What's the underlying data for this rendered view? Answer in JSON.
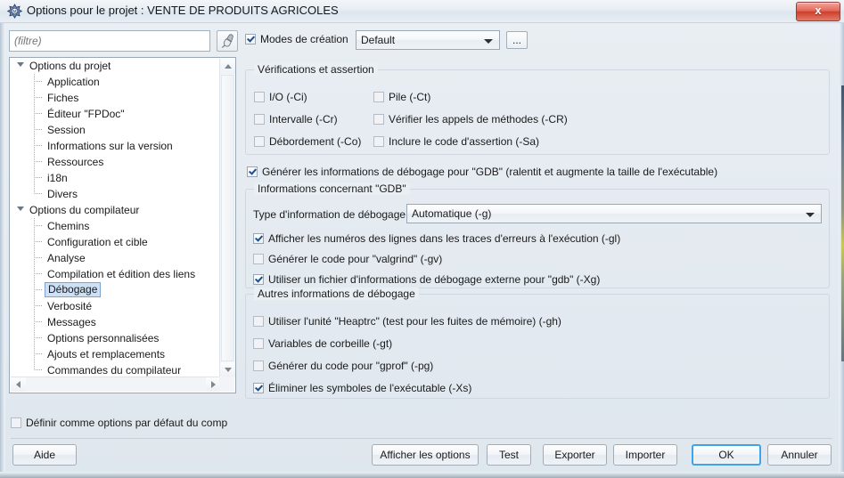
{
  "window": {
    "title": "Options pour le projet : VENTE DE PRODUITS AGRICOLES",
    "app_icon": "lazarus-icon",
    "close_label": "x",
    "accent": "#3ea4e8",
    "close_color": "#cf3f2c"
  },
  "filter": {
    "placeholder": "(filtre)",
    "value": "",
    "clear_icon": "brush-icon"
  },
  "tree": {
    "items": [
      {
        "label": "Options du projet",
        "level": 0,
        "expanded": true,
        "selected": false
      },
      {
        "label": "Application",
        "level": 1,
        "expanded": false,
        "selected": false
      },
      {
        "label": "Fiches",
        "level": 1,
        "expanded": false,
        "selected": false
      },
      {
        "label": "Éditeur \"FPDoc\"",
        "level": 1,
        "expanded": false,
        "selected": false
      },
      {
        "label": "Session",
        "level": 1,
        "expanded": false,
        "selected": false
      },
      {
        "label": "Informations sur la version",
        "level": 1,
        "expanded": false,
        "selected": false
      },
      {
        "label": "Ressources",
        "level": 1,
        "expanded": false,
        "selected": false
      },
      {
        "label": "i18n",
        "level": 1,
        "expanded": false,
        "selected": false
      },
      {
        "label": "Divers",
        "level": 1,
        "expanded": false,
        "selected": false
      },
      {
        "label": "Options du compilateur",
        "level": 0,
        "expanded": true,
        "selected": false
      },
      {
        "label": "Chemins",
        "level": 1,
        "expanded": false,
        "selected": false
      },
      {
        "label": "Configuration et cible",
        "level": 1,
        "expanded": false,
        "selected": false
      },
      {
        "label": "Analyse",
        "level": 1,
        "expanded": false,
        "selected": false
      },
      {
        "label": "Compilation et édition des liens",
        "level": 1,
        "expanded": false,
        "selected": false
      },
      {
        "label": "Débogage",
        "level": 1,
        "expanded": false,
        "selected": true
      },
      {
        "label": "Verbosité",
        "level": 1,
        "expanded": false,
        "selected": false
      },
      {
        "label": "Messages",
        "level": 1,
        "expanded": false,
        "selected": false
      },
      {
        "label": "Options personnalisées",
        "level": 1,
        "expanded": false,
        "selected": false
      },
      {
        "label": "Ajouts et remplacements",
        "level": 1,
        "expanded": false,
        "selected": false
      },
      {
        "label": "Commandes du compilateur",
        "level": 1,
        "expanded": false,
        "selected": false
      }
    ]
  },
  "left_bottom": {
    "default_options_label": "Définir comme options par défaut du comp",
    "default_options_checked": false
  },
  "topbar": {
    "build_modes_label": "Modes de création",
    "build_modes_checked": true,
    "build_mode_value": "Default",
    "more_button_label": "..."
  },
  "verifications_group": {
    "title": "Vérifications et assertion",
    "checks": [
      {
        "label": "I/O (-Ci)",
        "checked": false
      },
      {
        "label": "Pile (-Ct)",
        "checked": false
      },
      {
        "label": "Intervalle (-Cr)",
        "checked": false
      },
      {
        "label": "Vérifier les appels de méthodes (-CR)",
        "checked": false
      },
      {
        "label": "Débordement (-Co)",
        "checked": false
      },
      {
        "label": "Inclure le code d'assertion (-Sa)",
        "checked": false
      }
    ]
  },
  "debug_info": {
    "generate_label": "Générer les informations de débogage pour \"GDB\" (ralentit et augmente la taille de l'exécutable)",
    "generate_checked": true,
    "group_title": "Informations concernant \"GDB\"",
    "type_label": "Type d'information de débogage",
    "type_value": "Automatique (-g)",
    "options": [
      {
        "label": "Afficher les numéros des lignes dans les traces d'erreurs à l'exécution (-gl)",
        "checked": true
      },
      {
        "label": "Générer le code pour \"valgrind\" (-gv)",
        "checked": false
      },
      {
        "label": "Utiliser un fichier d'informations de débogage externe pour \"gdb\" (-Xg)",
        "checked": true
      }
    ]
  },
  "other_debug": {
    "group_title": "Autres informations de débogage",
    "options": [
      {
        "label": "Utiliser l'unité \"Heaptrc\" (test pour les fuites de mémoire) (-gh)",
        "checked": false
      },
      {
        "label": "Variables de corbeille (-gt)",
        "checked": false
      },
      {
        "label": "Générer du code pour \"gprof\" (-pg)",
        "checked": false
      },
      {
        "label": "Éliminer les symboles de l'exécutable (-Xs)",
        "checked": true
      }
    ]
  },
  "buttons": {
    "help": "Aide",
    "show_options": "Afficher les options",
    "test": "Test",
    "export": "Exporter",
    "import": "Importer",
    "ok": "OK",
    "cancel": "Annuler"
  }
}
